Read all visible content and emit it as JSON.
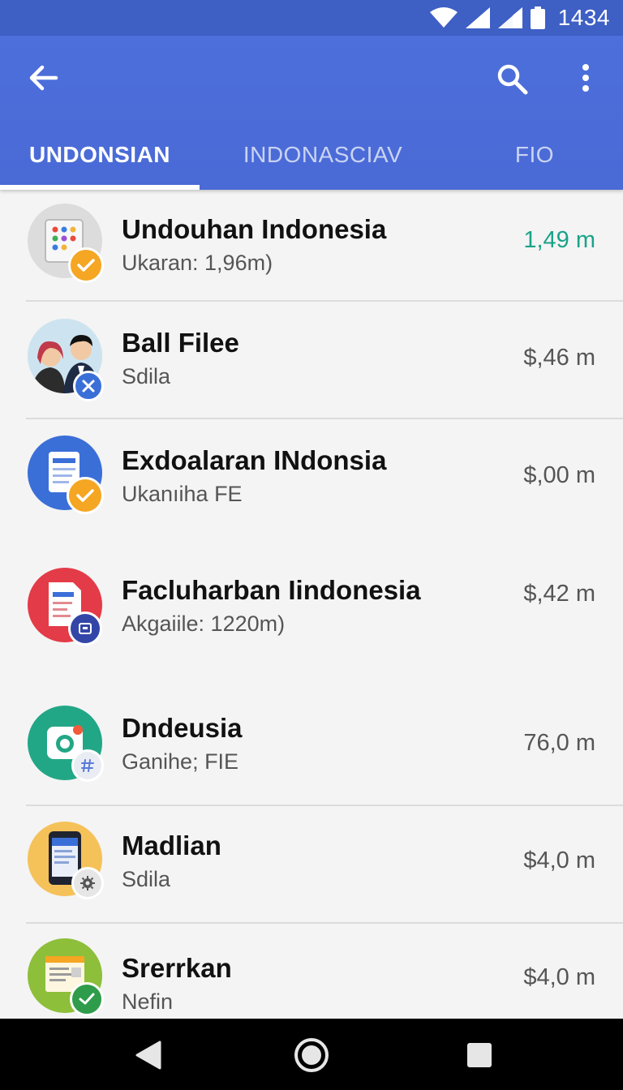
{
  "status_bar": {
    "time": "1434"
  },
  "app_bar": {
    "tabs": [
      {
        "label": "UNDONSIAN",
        "active": true
      },
      {
        "label": "INDONASCIAV",
        "active": false
      },
      {
        "label": "FIO",
        "active": false
      }
    ]
  },
  "colors": {
    "primary": "#4a6fd8",
    "status_bar": "#3e5fc4",
    "accent_green": "#1aa389"
  },
  "list": [
    {
      "title": "Undouhan Indonesia",
      "subtitle": "Ukaran: 1,96m)",
      "size": "1,49 m",
      "icon": "app-grid-icon"
    },
    {
      "title": "Ball Filee",
      "subtitle": "Sdila",
      "size": "$,46 m",
      "icon": "couple-avatar"
    },
    {
      "title": "Exdoalaran INdonsia",
      "subtitle": "Ukanıiha FE",
      "size": "$,00 m",
      "icon": "document-icon"
    },
    {
      "title": "Facluharban Iindonesia",
      "subtitle": "Akgaiile: 1220m)",
      "size": "$,42 m",
      "icon": "file-icon"
    },
    {
      "title": "Dndeusia",
      "subtitle": "Ganihe; FIE",
      "size": "76,0 m",
      "icon": "camera-icon"
    },
    {
      "title": "Madlian",
      "subtitle": "Sdila",
      "size": "$4,0 m",
      "icon": "phone-icon"
    },
    {
      "title": "Srerrkan",
      "subtitle": "Nefin",
      "size": "$4,0 m",
      "icon": "notes-icon"
    }
  ]
}
